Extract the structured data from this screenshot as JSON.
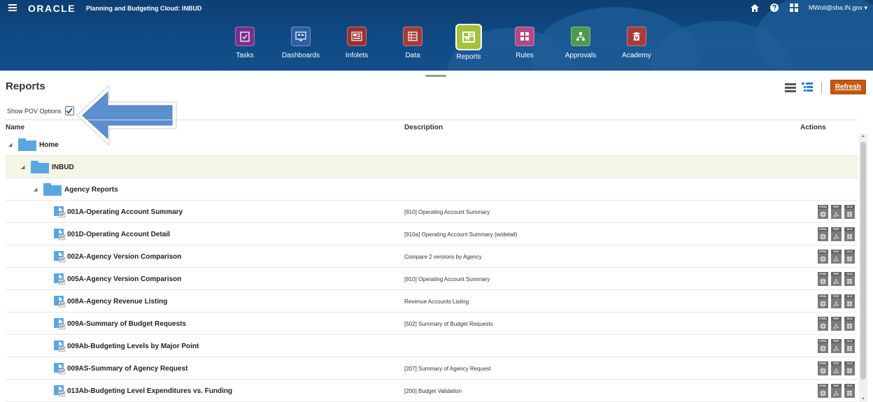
{
  "header": {
    "brand": "ORACLE",
    "app_title": "Planning and Budgeting Cloud: INBUD",
    "user": "MWoll@sba.IN.gov ▾",
    "icons": [
      "menu-icon",
      "home-icon",
      "help-icon",
      "navigator-icon"
    ]
  },
  "nav": [
    {
      "label": "Tasks",
      "icon": "tasks-icon",
      "color": "#7a2f8a",
      "active": false
    },
    {
      "label": "Dashboards",
      "icon": "dashboards-icon",
      "color": "#2e5ea3",
      "active": false
    },
    {
      "label": "Infolets",
      "icon": "infolets-icon",
      "color": "#9a3030",
      "active": false
    },
    {
      "label": "Data",
      "icon": "data-icon",
      "color": "#a53a3a",
      "active": false
    },
    {
      "label": "Reports",
      "icon": "reports-icon",
      "color": "#a4c23a",
      "active": true
    },
    {
      "label": "Rules",
      "icon": "rules-icon",
      "color": "#b24a84",
      "active": false
    },
    {
      "label": "Approvals",
      "icon": "approvals-icon",
      "color": "#4c9a4c",
      "active": false
    },
    {
      "label": "Academy",
      "icon": "academy-icon",
      "color": "#a63c3c",
      "active": false
    }
  ],
  "page": {
    "title": "Reports",
    "refresh_label": "Refresh",
    "pov_label": "Show POV Options",
    "pov_checked": true
  },
  "table": {
    "headers": {
      "name": "Name",
      "description": "Description",
      "actions": "Actions"
    },
    "rows": [
      {
        "type": "folder",
        "level": 0,
        "name": "Home",
        "description": "",
        "selected": false
      },
      {
        "type": "folder",
        "level": 1,
        "name": "INBUD",
        "description": "",
        "selected": true
      },
      {
        "type": "folder",
        "level": 2,
        "name": "Agency Reports",
        "description": "",
        "selected": false
      },
      {
        "type": "report",
        "level": 3,
        "name": "001A-Operating Account Summary",
        "description": "[910] Operating Account Summary",
        "selected": false
      },
      {
        "type": "report",
        "level": 3,
        "name": "001D-Operating Account Detail",
        "description": "[910a] Operating Account Summary (w/detail)",
        "selected": false
      },
      {
        "type": "report",
        "level": 3,
        "name": "002A-Agency Version Comparison",
        "description": "Compare 2 versions by Agency",
        "selected": false
      },
      {
        "type": "report",
        "level": 3,
        "name": "005A-Agency Version Comparison",
        "description": "[910] Operating Account Summary",
        "selected": false
      },
      {
        "type": "report",
        "level": 3,
        "name": "008A-Agency Revenue Listing",
        "description": "Revenue Accounts Listing",
        "selected": false
      },
      {
        "type": "report",
        "level": 3,
        "name": "009A-Summary of Budget Requests",
        "description": "[502] Summary of Budget Requests",
        "selected": false
      },
      {
        "type": "report",
        "level": 3,
        "name": "009Ab-Budgeting Levels by Major Point",
        "description": "",
        "selected": false
      },
      {
        "type": "report",
        "level": 3,
        "name": "009AS-Summary of Agency Request",
        "description": "[207] Summary of Agency Request",
        "selected": false
      },
      {
        "type": "report",
        "level": 3,
        "name": "013Ab-Budgeting Level Expenditures vs. Funding",
        "description": "[200] Budget Validation",
        "selected": false
      }
    ],
    "action_tags": [
      "HTML",
      "PDF",
      "XLS"
    ]
  }
}
